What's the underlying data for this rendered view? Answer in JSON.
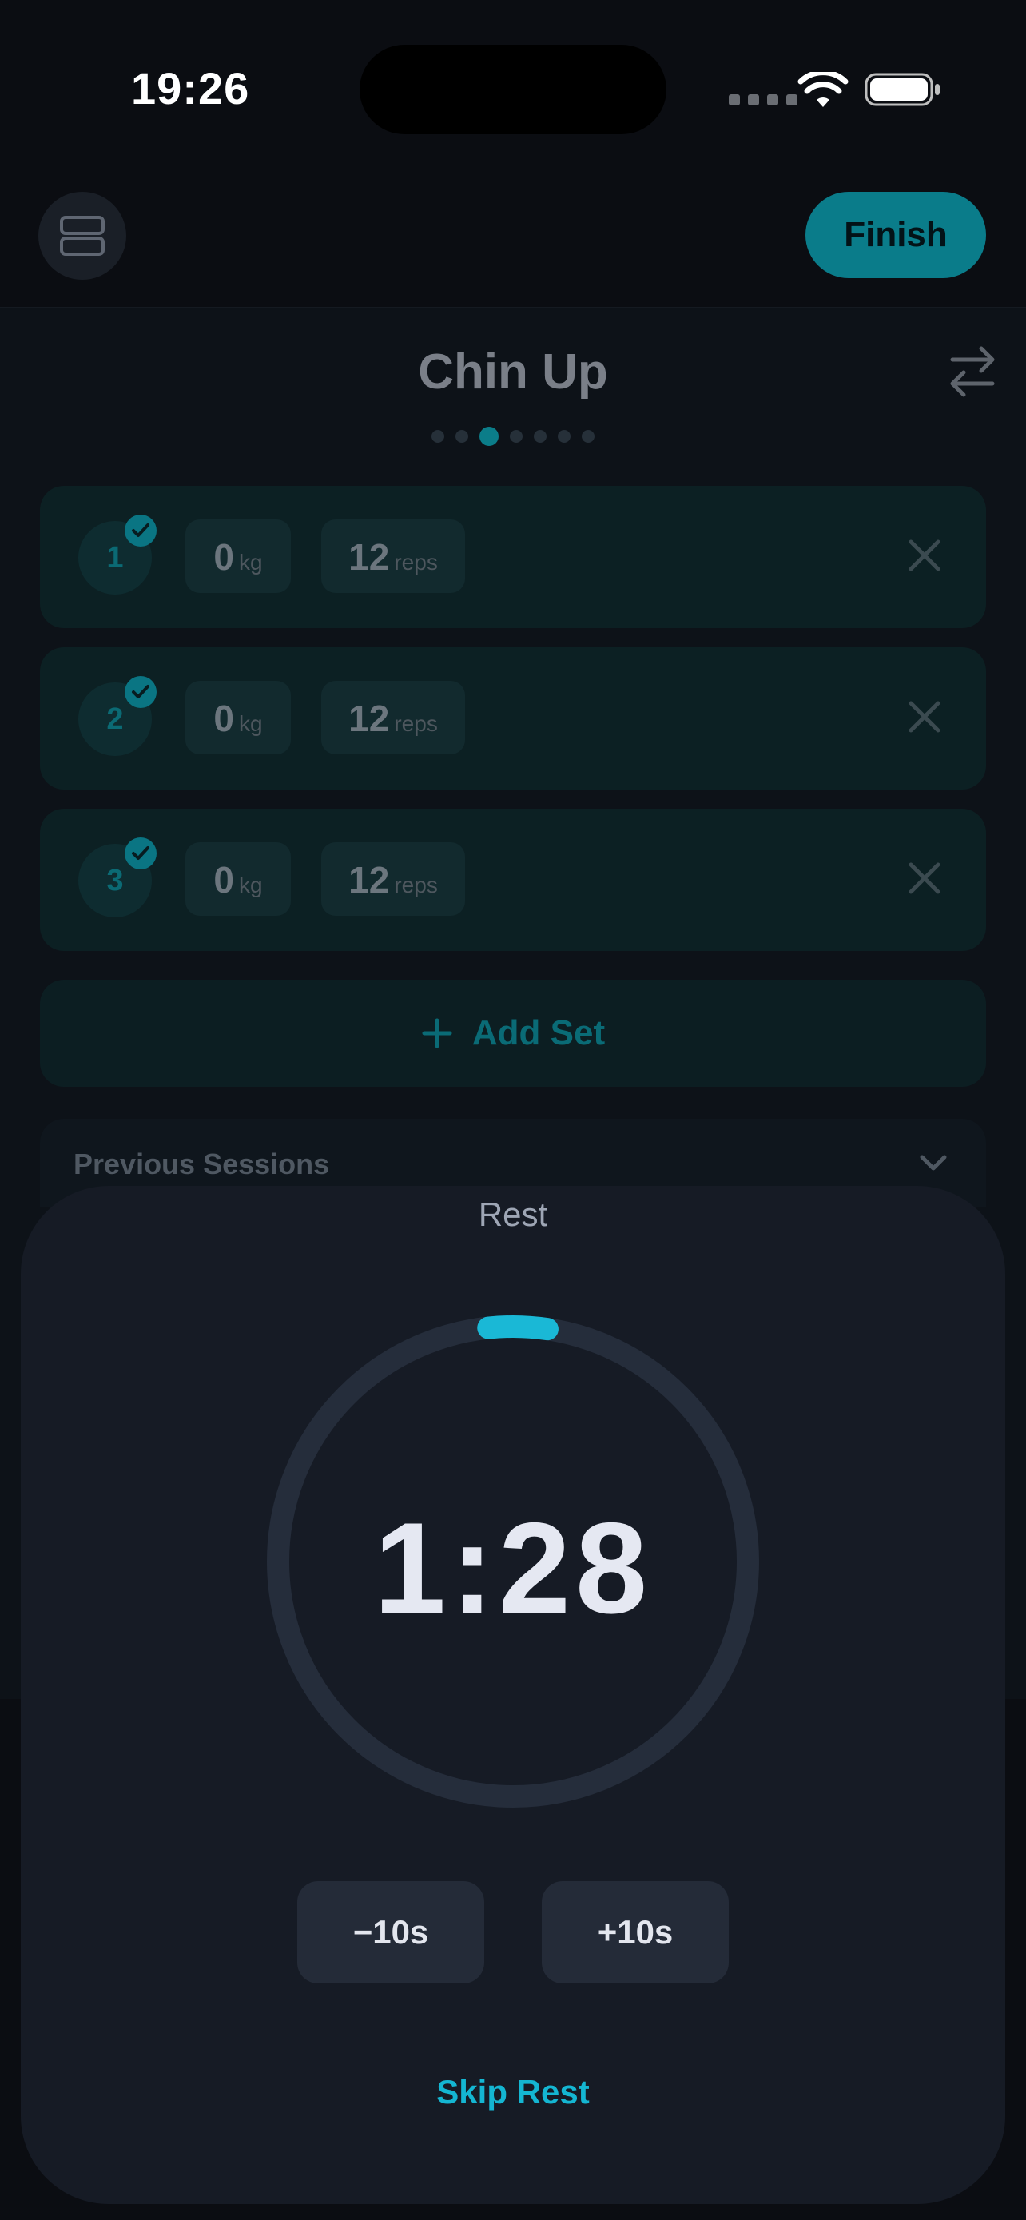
{
  "status_bar": {
    "time": "19:26"
  },
  "header": {
    "finish_label": "Finish"
  },
  "exercise": {
    "title": "Chin Up",
    "page_count": 7,
    "active_page": 2
  },
  "sets": [
    {
      "number": "1",
      "weight": "0",
      "weight_unit": "kg",
      "reps": "12",
      "reps_unit": "reps",
      "completed": true
    },
    {
      "number": "2",
      "weight": "0",
      "weight_unit": "kg",
      "reps": "12",
      "reps_unit": "reps",
      "completed": true
    },
    {
      "number": "3",
      "weight": "0",
      "weight_unit": "kg",
      "reps": "12",
      "reps_unit": "reps",
      "completed": true
    }
  ],
  "add_set_label": "Add Set",
  "previous_sessions_label": "Previous Sessions",
  "rest": {
    "title": "Rest",
    "time": "1:28",
    "progress": 0.04,
    "minus_label": "−10s",
    "plus_label": "+10s",
    "skip_label": "Skip Rest"
  },
  "colors": {
    "accent": "#0a7c8a",
    "timer_progress": "#1ab8d6",
    "background": "#0b0d12",
    "sheet": "#161b25"
  }
}
